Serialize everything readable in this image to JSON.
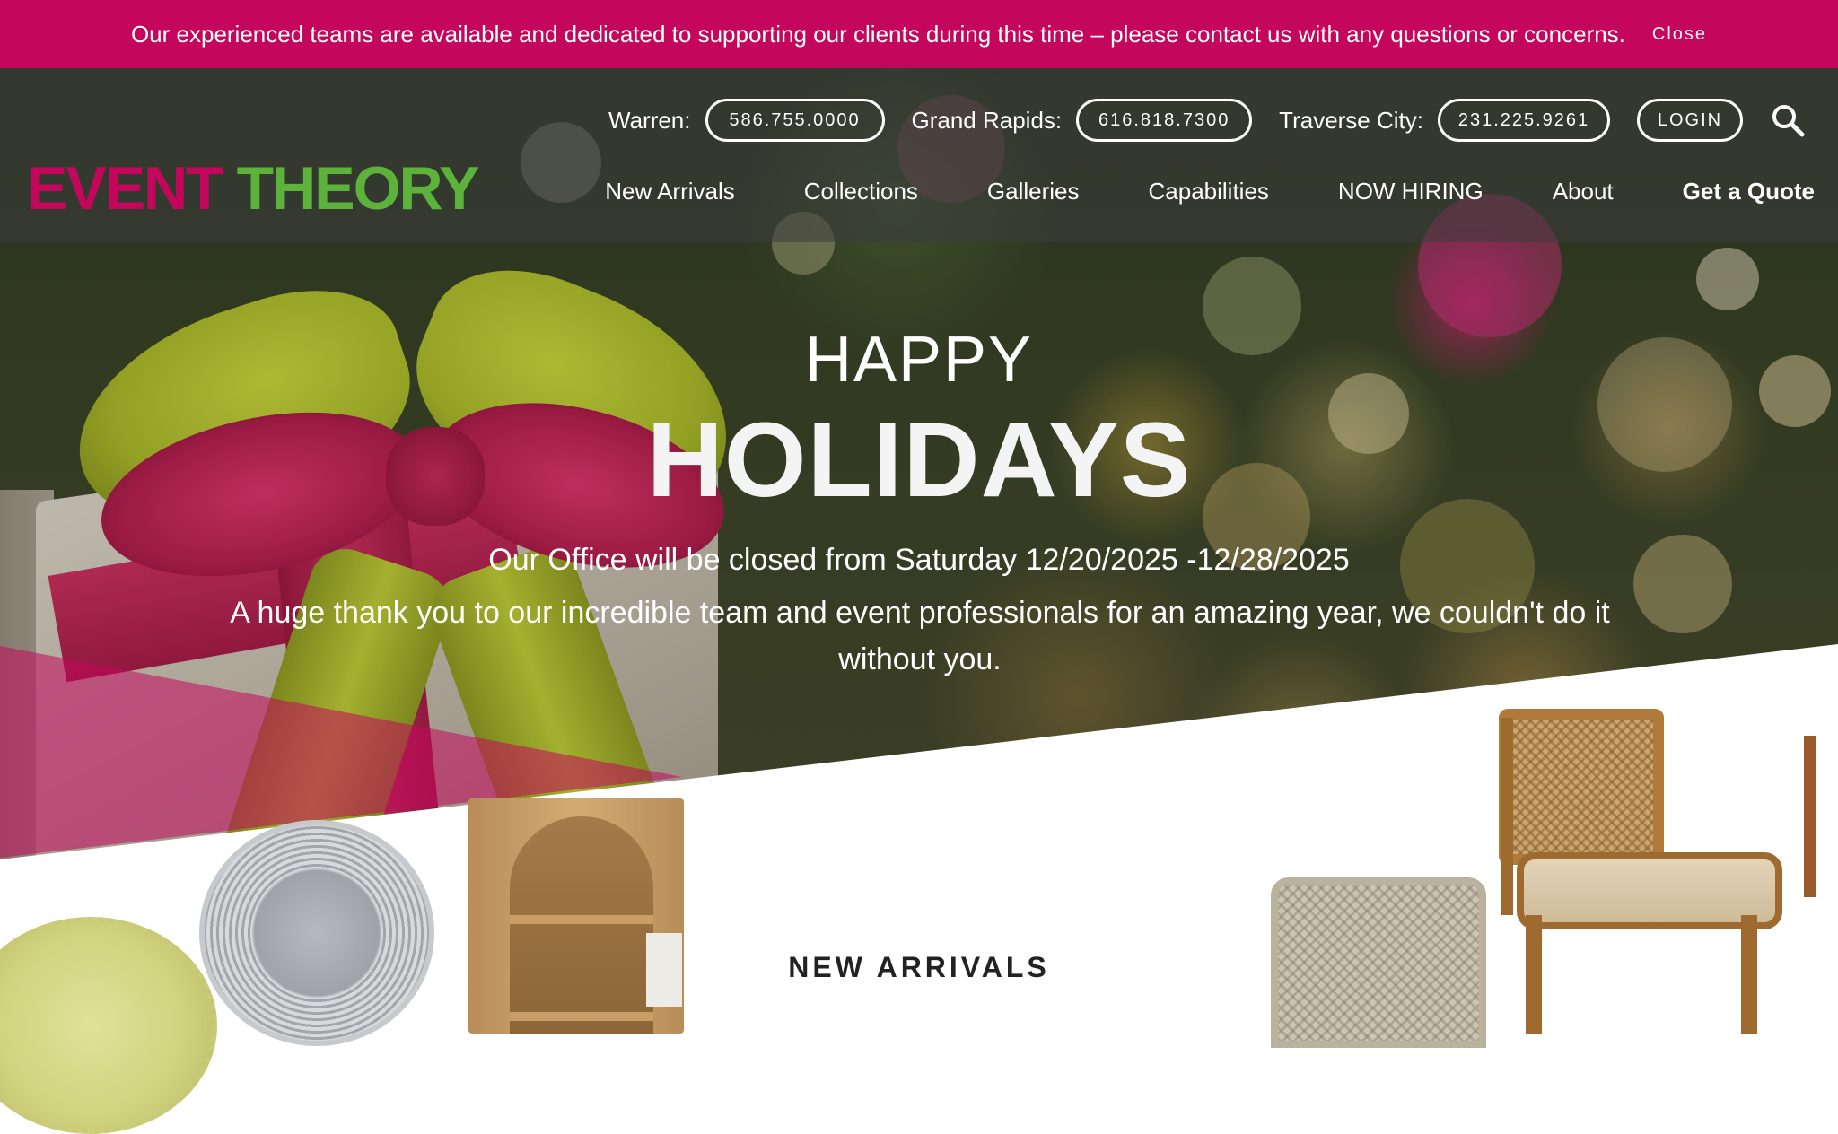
{
  "announcement": {
    "text": "Our experienced teams are available and dedicated to supporting our clients during this time – please contact us with any questions or concerns.",
    "close_label": "Close"
  },
  "header": {
    "logo": {
      "word1": "EVENT",
      "word2": "THEORY"
    },
    "locations": [
      {
        "label": "Warren:",
        "phone": "586.755.0000"
      },
      {
        "label": "Grand Rapids:",
        "phone": "616.818.7300"
      },
      {
        "label": "Traverse City:",
        "phone": "231.225.9261"
      }
    ],
    "login_label": "LOGIN",
    "search_icon": "search-icon",
    "nav": [
      "New Arrivals",
      "Collections",
      "Galleries",
      "Capabilities",
      "NOW HIRING",
      "About",
      "Get a Quote"
    ]
  },
  "hero": {
    "line1": "HAPPY",
    "line2": "HOLIDAYS",
    "closed_notice": "Our Office will be closed from Saturday 12/20/2025 -12/28/2025",
    "thanks": "A huge thank you to our incredible team and event professionals for an amazing year, we couldn't do it without you."
  },
  "products": {
    "heading": "NEW ARRIVALS"
  },
  "colors": {
    "brand_pink": "#c4075c",
    "brand_green": "#5cb23a",
    "header_overlay": "rgba(60,60,60,0.55)"
  }
}
